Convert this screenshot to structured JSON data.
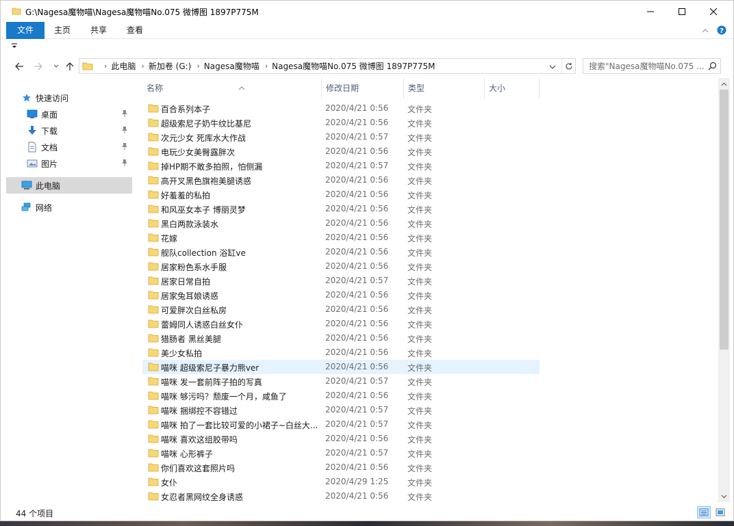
{
  "window": {
    "title": "G:\\Nagesa魔物喵\\Nagesa魔物喵No.075 微博图 1897P775M"
  },
  "ribbon": {
    "tabs": [
      "文件",
      "主页",
      "共享",
      "查看"
    ]
  },
  "address": {
    "crumbs": [
      "此电脑",
      "新加卷 (G:)",
      "Nagesa魔物喵",
      "Nagesa魔物喵No.075 微博图 1897P775M"
    ]
  },
  "search": {
    "placeholder": "搜索\"Nagesa魔物喵No.075 ..."
  },
  "nav": {
    "quick_access": "快速访问",
    "items": [
      {
        "label": "桌面",
        "icon": "desktop-icon",
        "pinned": true
      },
      {
        "label": "下载",
        "icon": "download-icon",
        "pinned": true
      },
      {
        "label": "文档",
        "icon": "documents-icon",
        "pinned": true
      },
      {
        "label": "图片",
        "icon": "pictures-icon",
        "pinned": true
      }
    ],
    "this_pc": "此电脑",
    "network": "网络"
  },
  "columns": {
    "name": "名称",
    "date": "修改日期",
    "type": "类型",
    "size": "大小"
  },
  "files": [
    {
      "name": "百合系列本子",
      "date": "2020/4/21 0:56",
      "type": "文件夹"
    },
    {
      "name": "超级索尼子奶牛纹比基尼",
      "date": "2020/4/21 0:56",
      "type": "文件夹"
    },
    {
      "name": "次元少女 死库水大作战",
      "date": "2020/4/21 0:57",
      "type": "文件夹"
    },
    {
      "name": "电玩少女美臀露胖次",
      "date": "2020/4/21 0:56",
      "type": "文件夹"
    },
    {
      "name": "掉HP期不敢多拍照，怕侧漏",
      "date": "2020/4/21 0:57",
      "type": "文件夹"
    },
    {
      "name": "高开叉黑色旗袍美腿诱惑",
      "date": "2020/4/21 0:56",
      "type": "文件夹"
    },
    {
      "name": "好羞羞的私拍",
      "date": "2020/4/21 0:56",
      "type": "文件夹"
    },
    {
      "name": "和风巫女本子 博丽灵梦",
      "date": "2020/4/21 0:56",
      "type": "文件夹"
    },
    {
      "name": "黑白两款泳装水",
      "date": "2020/4/21 0:56",
      "type": "文件夹"
    },
    {
      "name": "花嫁",
      "date": "2020/4/21 0:56",
      "type": "文件夹"
    },
    {
      "name": "舰队collection 浴缸ve",
      "date": "2020/4/21 0:56",
      "type": "文件夹"
    },
    {
      "name": "居家粉色系水手服",
      "date": "2020/4/21 0:56",
      "type": "文件夹"
    },
    {
      "name": "居家日常自拍",
      "date": "2020/4/21 0:57",
      "type": "文件夹"
    },
    {
      "name": "居家兔耳娘诱惑",
      "date": "2020/4/21 0:56",
      "type": "文件夹"
    },
    {
      "name": "可爱胖次白丝私房",
      "date": "2020/4/21 0:56",
      "type": "文件夹"
    },
    {
      "name": "蕾姆同人诱惑白丝女仆",
      "date": "2020/4/21 0:56",
      "type": "文件夹"
    },
    {
      "name": "猎肠者 黑丝美腿",
      "date": "2020/4/21 0:56",
      "type": "文件夹"
    },
    {
      "name": "美少女私拍",
      "date": "2020/4/21 0:56",
      "type": "文件夹"
    },
    {
      "name": "喵咪 超级索尼子暴力熊ver",
      "date": "2020/4/21 0:56",
      "type": "文件夹",
      "hover": true
    },
    {
      "name": "喵咪 发一套前阵子拍的写真",
      "date": "2020/4/21 0:57",
      "type": "文件夹"
    },
    {
      "name": "喵咪 够污吗？颓废一个月，咸鱼了",
      "date": "2020/4/21 0:56",
      "type": "文件夹"
    },
    {
      "name": "喵咪 捆绑控不容错过",
      "date": "2020/4/21 0:57",
      "type": "文件夹"
    },
    {
      "name": "喵咪 拍了一套比较可爱的小裙子~白丝大...",
      "date": "2020/4/21 0:57",
      "type": "文件夹"
    },
    {
      "name": "喵咪 喜欢这组胶带吗",
      "date": "2020/4/21 0:56",
      "type": "文件夹"
    },
    {
      "name": "喵咪 心形裤子",
      "date": "2020/4/21 0:57",
      "type": "文件夹"
    },
    {
      "name": "你们喜欢这套照片吗",
      "date": "2020/4/21 0:56",
      "type": "文件夹"
    },
    {
      "name": "女仆",
      "date": "2020/4/29 1:25",
      "type": "文件夹"
    },
    {
      "name": "女忍者黑网纹全身诱惑",
      "date": "2020/4/21 0:56",
      "type": "文件夹"
    }
  ],
  "status": {
    "count": "44 个项目"
  },
  "colors": {
    "accent": "#1979ca",
    "folder": "#f8d775",
    "hover_row": "#e5f3ff",
    "selected_nav": "#d9d9d9"
  }
}
